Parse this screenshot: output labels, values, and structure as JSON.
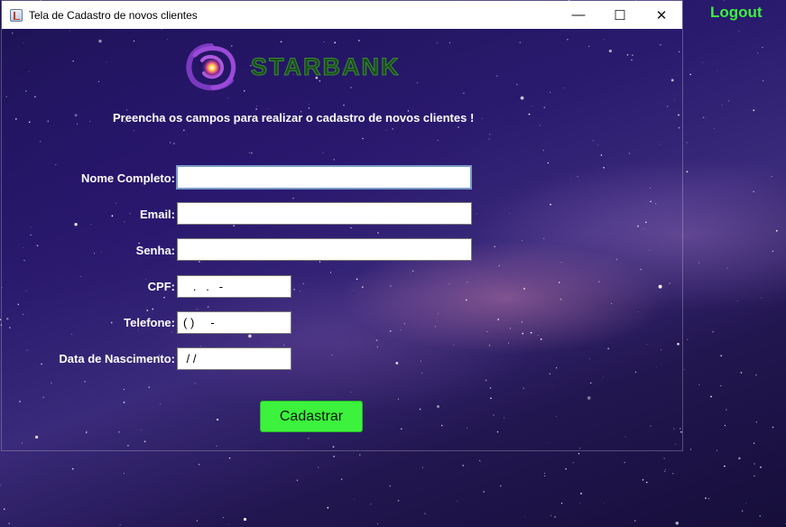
{
  "window": {
    "title": "Tela de Cadastro de novos clientes"
  },
  "title_controls": {
    "minimize": "—",
    "maximize": "☐",
    "close": "✕"
  },
  "logout": {
    "label": "Logout"
  },
  "logo": {
    "brand": "STARBANK",
    "color": "#3a8a3a"
  },
  "instruction": "Preencha os campos para realizar o cadastro de novos clientes !",
  "form": {
    "nome": {
      "label": "Nome Completo:",
      "value": ""
    },
    "email": {
      "label": "Email:",
      "value": ""
    },
    "senha": {
      "label": "Senha:",
      "value": ""
    },
    "cpf": {
      "label": "CPF:",
      "value": "   .   .   -"
    },
    "telefone": {
      "label": "Telefone:",
      "value": "( )     -"
    },
    "nascimento": {
      "label": "Data de Nascimento:",
      "value": " / /"
    }
  },
  "submit": {
    "label": "Cadastrar"
  },
  "colors": {
    "accent": "#3cf23c",
    "background": "#1b1250"
  }
}
